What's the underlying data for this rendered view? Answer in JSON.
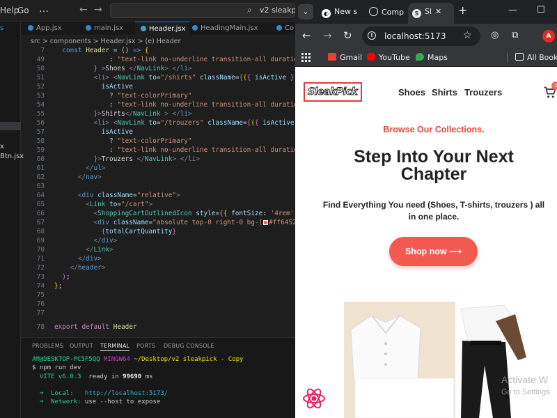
{
  "vscode": {
    "menu": [
      "Help",
      "Go"
    ],
    "more": "…",
    "search_text": "v2 sleakpick",
    "sidebar_partial": [
      "s",
      "x",
      "Btn.jsx"
    ],
    "tabs": [
      "App.jsx",
      "main.jsx",
      "Header.jsx",
      "HeadingMain.jsx",
      "Co"
    ],
    "active_tab": "Header.jsx",
    "breadcrumb": "src > components > Header.jsx > (e) Header",
    "code": {
      "l7": "7",
      "l48": "48",
      "l49": "49",
      "l50": "50",
      "l51": "51",
      "l52": "52",
      "l53": "53",
      "l54": "54",
      "l55": "55",
      "l56": "56",
      "l57": "57",
      "l58": "58",
      "l59": "59",
      "l60": "60",
      "l61": "61",
      "l62": "62",
      "l63": "63",
      "l64": "64",
      "l65": "65",
      "l66": "66",
      "l67": "67",
      "l68": "68",
      "l69": "69",
      "l70": "70",
      "l71": "71",
      "l72": "72",
      "l73": "73",
      "l74": "74",
      "l75": "75",
      "l76": "76",
      "l77": "77",
      "l78": "78"
    },
    "terminal": {
      "tabs": [
        "PROBLEMS",
        "OUTPUT",
        "TERMINAL",
        "PORTS",
        "DEBUG CONSOLE"
      ],
      "active": "TERMINAL",
      "prompt_user": "AM@DESKTOP-PC5F5QQ",
      "prompt_env": "MINGW64",
      "prompt_path": "~/Desktop/v2 sleakpick - Copy",
      "command": "$ npm run dev",
      "vite": "VITE v6.0.3",
      "ready": "ready in",
      "ready_ms": "99690",
      "ms": "ms",
      "local_label": "➜  Local:",
      "local_url": "http://localhost:5173/",
      "network_label": "➜  Network:",
      "network_text": "use --host to expose"
    }
  },
  "chrome": {
    "tab_menu": "⌄",
    "tabs": [
      {
        "label": "New s",
        "favicon": "github-icon"
      },
      {
        "label": "Comp",
        "favicon": "chatgpt-icon"
      },
      {
        "label": "Sl",
        "favicon": "sleakpick-icon",
        "active": true
      }
    ],
    "favicon_letter": "S",
    "close": "✕",
    "new_tab": "+",
    "url": "localhost:5173",
    "avatar_letter": "A",
    "bookmarks": [
      "Gmail",
      "YouTube",
      "Maps",
      "All Bookm"
    ],
    "window_controls": [
      "—",
      "☐"
    ]
  },
  "site": {
    "brand": "SleakPick",
    "nav": [
      "Shoes",
      "Shirts",
      "Trouzers"
    ],
    "cart_count": "3",
    "kicker": "Browse Our Collections.",
    "headline_line1": "Step Into Your Next",
    "headline_line2": "Chapter",
    "sub": "Find Everything You need (Shoes, T-shirts, trouzers ) all in one place.",
    "cta": "Shop now ⟶",
    "watermark_title": "Activate W",
    "watermark_sub": "Go to Settings"
  },
  "colors": {
    "accent": "#f25a50",
    "brand_border": "#e03a3e",
    "kicker": "#e34c3e",
    "vscode_bg": "#1e1e1e",
    "chrome_dark": "#35363a"
  }
}
